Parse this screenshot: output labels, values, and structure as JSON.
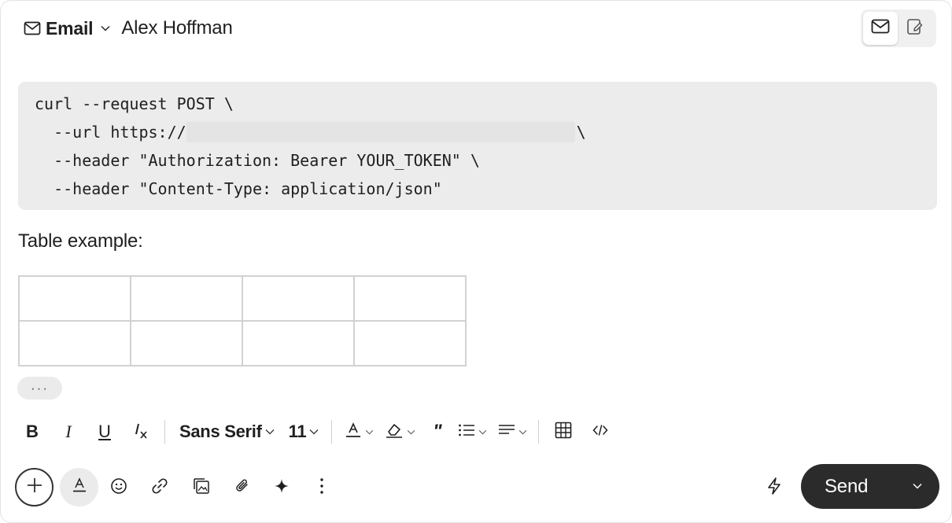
{
  "header": {
    "channel_label": "Email",
    "recipient": "Alex Hoffman"
  },
  "code_block": {
    "line1": "curl --request POST \\",
    "line2_prefix": "  --url https://",
    "line2_suffix": "\\",
    "line3": "  --header \"Authorization: Bearer YOUR_TOKEN\" \\",
    "line4": "  --header \"Content-Type: application/json\""
  },
  "body": {
    "table_label": "Table example:",
    "table": {
      "rows": [
        [
          "",
          "",
          "",
          ""
        ],
        [
          "",
          "",
          "",
          ""
        ]
      ]
    },
    "more_label": "···"
  },
  "format_toolbar": {
    "bold": "B",
    "italic": "I",
    "underline": "U",
    "font_family": "Sans Serif",
    "font_size": "11"
  },
  "bottom_bar": {
    "send_label": "Send"
  },
  "icons": {
    "header": [
      "mail-icon",
      "chevron-down-icon"
    ],
    "toggle": [
      "mail-icon",
      "compose-note-icon"
    ],
    "format": [
      "bold-icon",
      "italic-icon",
      "underline-icon",
      "clear-format-icon",
      "text-color-icon",
      "highlight-icon",
      "quote-icon",
      "bullet-list-icon",
      "align-icon",
      "table-icon",
      "code-icon"
    ],
    "bottom": [
      "plus-icon",
      "text-format-icon",
      "emoji-icon",
      "link-icon",
      "image-icon",
      "attachment-icon",
      "sparkle-icon",
      "more-vertical-icon",
      "lightning-icon",
      "chevron-down-icon"
    ]
  },
  "colors": {
    "send_bg": "#2b2b2b",
    "code_bg": "#ececec",
    "table_border": "#d2d2d2"
  }
}
